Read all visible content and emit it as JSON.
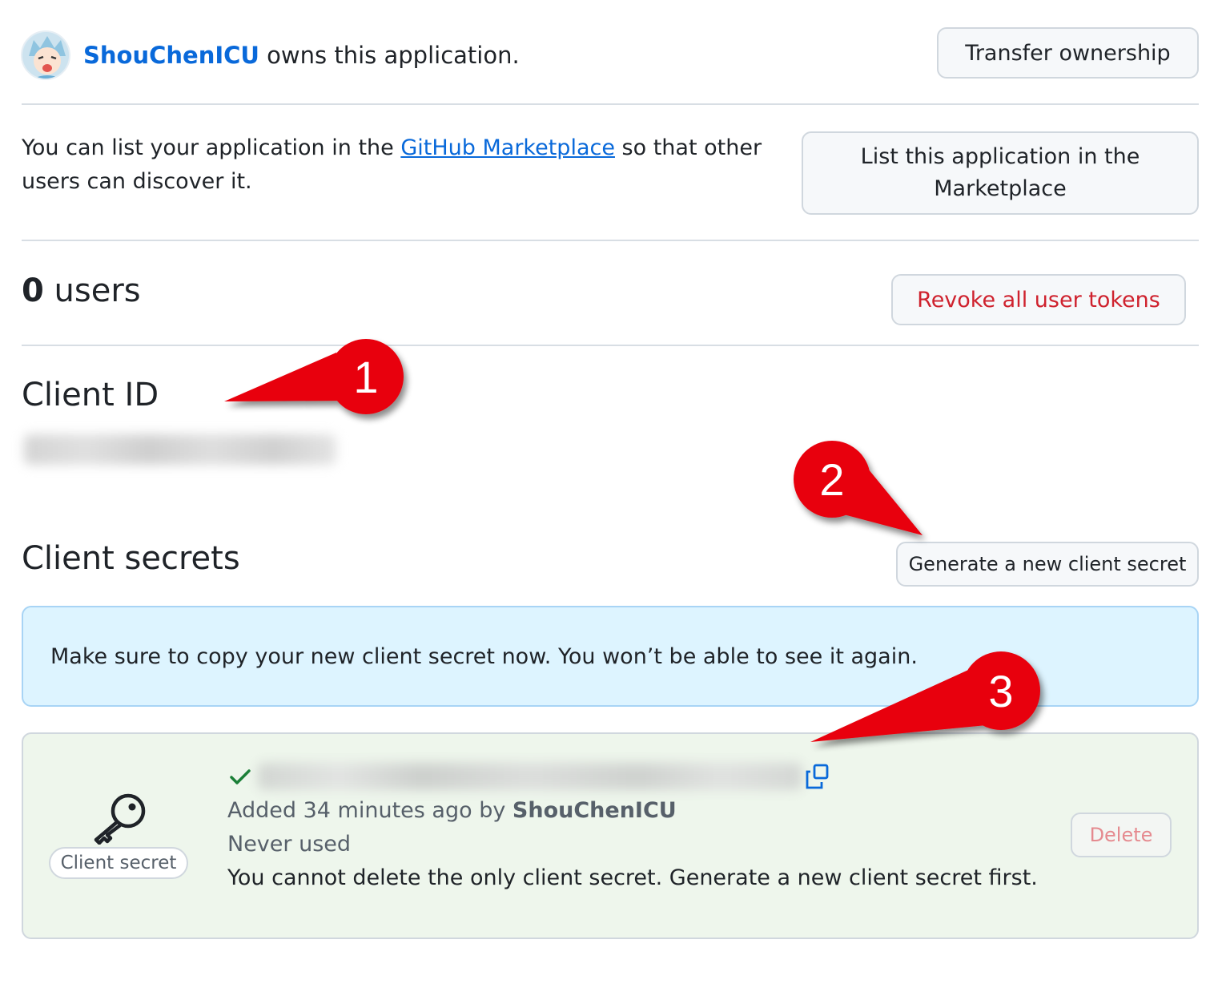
{
  "owner": {
    "username": "ShouChenICU",
    "suffix": " owns this application."
  },
  "transfer_button": "Transfer ownership",
  "marketplace": {
    "text_before": "You can list your application in the ",
    "link_text": "GitHub Marketplace",
    "text_after": " so that other users can discover it.",
    "button_label": "List this application in the Marketplace"
  },
  "users": {
    "count": "0",
    "label": " users",
    "revoke_button": "Revoke all user tokens"
  },
  "client_id": {
    "heading": "Client ID"
  },
  "client_secrets": {
    "heading": "Client secrets",
    "generate_button": "Generate a new client secret",
    "flash_message": "Make sure to copy your new client secret now. You won’t be able to see it again.",
    "item": {
      "label": "Client secret",
      "added_prefix": "Added 34 minutes ago by ",
      "added_by": "ShouChenICU",
      "usage": "Never used",
      "note": "You cannot delete the only client secret. Generate a new client secret first.",
      "delete_button": "Delete"
    }
  },
  "annotations": [
    "1",
    "2",
    "3"
  ],
  "colors": {
    "link": "#0969da",
    "danger": "#cf222e",
    "success": "#1a7f37",
    "annotation_red": "#e8000b",
    "flash_bg": "#ddf4ff",
    "secret_bg": "#eef6ec"
  }
}
